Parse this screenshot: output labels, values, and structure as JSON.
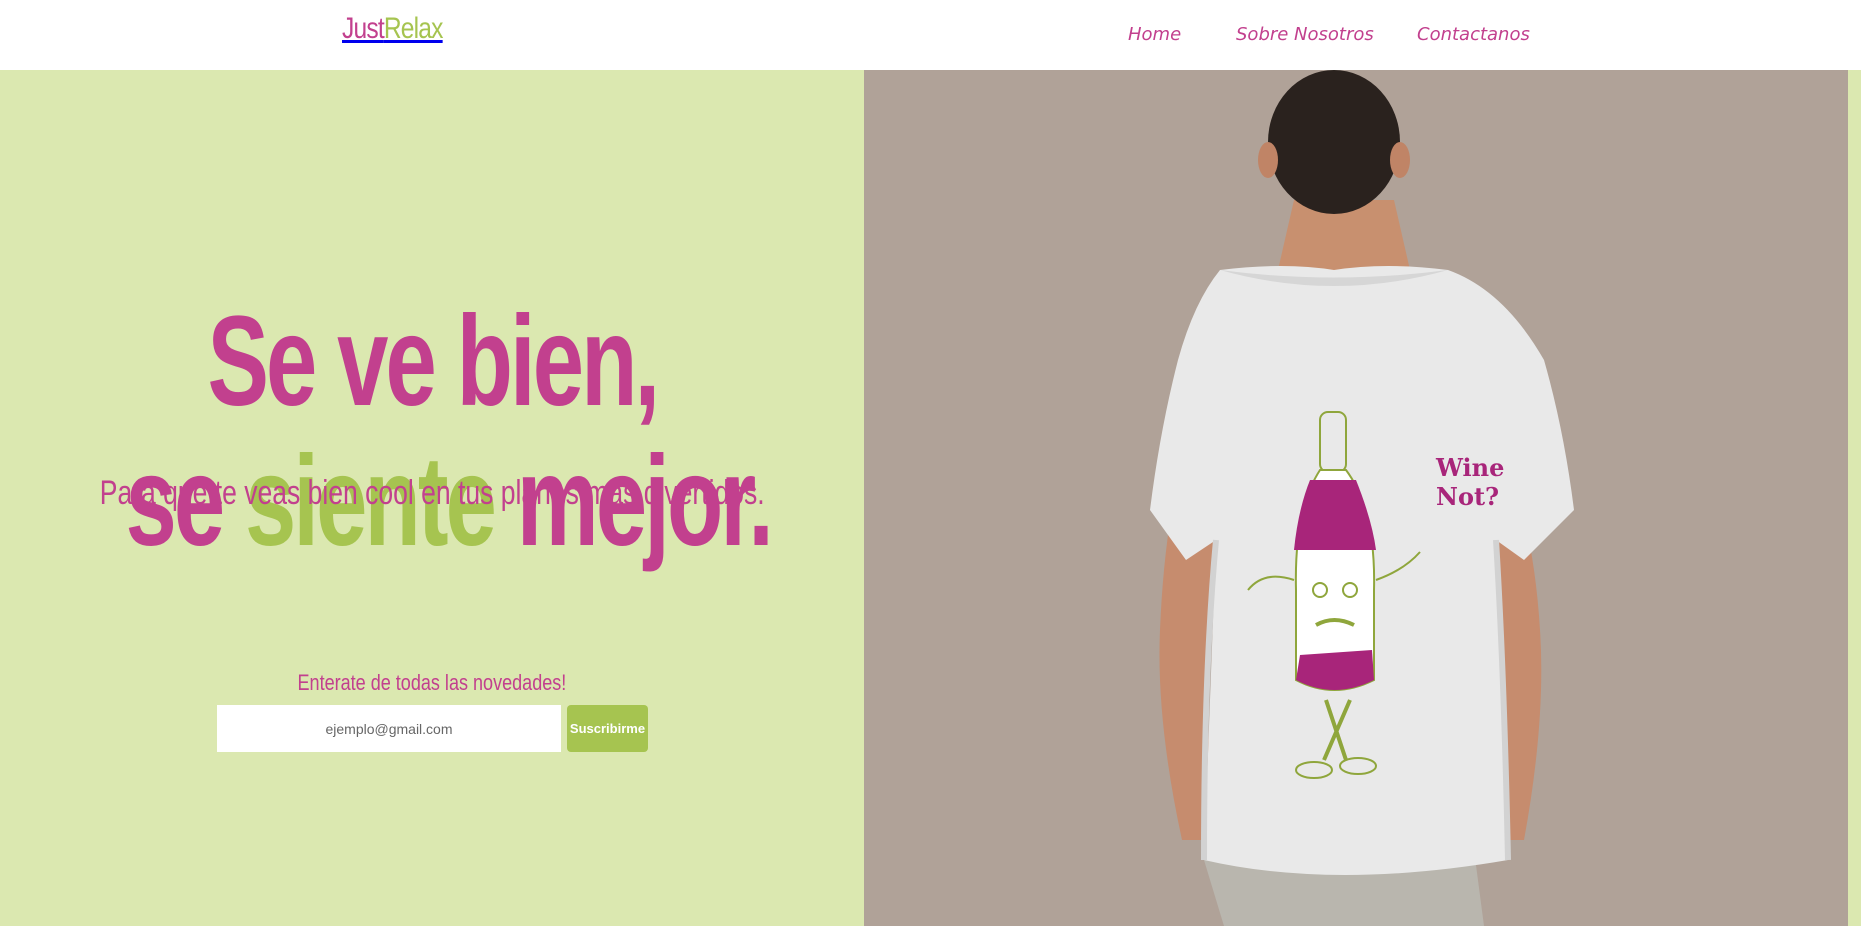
{
  "brand": {
    "part1": "Just",
    "part2": "Relax",
    "color_primary": "#c2408e",
    "color_secondary": "#a6c450"
  },
  "nav": {
    "items": [
      {
        "label": "Home"
      },
      {
        "label": "Sobre Nosotros"
      },
      {
        "label": "Contactanos"
      }
    ]
  },
  "hero": {
    "headline_line1": "Se ve bien,",
    "headline_line2_part1": "se ",
    "headline_line2_accent": "siente",
    "headline_line2_part2": " mejor.",
    "tagline": "Para que te veas bien cool en tus planes mas divertidos.",
    "background": "#dbe8b0"
  },
  "newsletter": {
    "title": "Enterate de todas las novedades!",
    "email_placeholder": "ejemplo@gmail.com",
    "email_value": "",
    "button_label": "Suscribirme"
  },
  "image": {
    "subject": "person-wearing-white-tshirt-back-view",
    "shirt_print_line1": "Wine",
    "shirt_print_line2": "Not?",
    "background": "#b0a298"
  }
}
